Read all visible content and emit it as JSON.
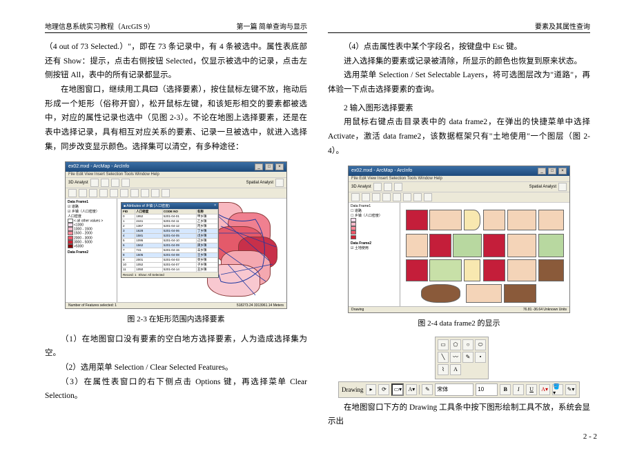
{
  "header": {
    "left": "地理信息系统实习教程（ArcGIS 9）",
    "center": "第一篇 简单查询与显示",
    "right": "要素及其属性查询"
  },
  "left_col": {
    "p1": "（4 out of 73 Selected.）\"，即在 73 条记录中，有 4 条被选中。属性表底部还有 Show：提示，点击右侧按钮 Selected，仅显示被选中的记录，点击左侧按钮 All，表中的所有记录都显示。",
    "p2": "在地图窗口，继续用工具🖾（选择要素），按住鼠标左键不放，拖动后形成一个矩形（俗称开窗），松开鼠标左键，和该矩形相交的要素都被选中，对应的属性记录也选中（见图 2-3）。不论在地图上选择要素，还是在表中选择记录，具有相互对应关系的要素、记录一旦被选中，就进入选择集，同步改变显示颜色。选择集可以清空，有多种途径：",
    "caption": "图 2-3 在矩形范围内选择要素",
    "p3": "（1）在地图窗口没有要素的空白地方选择要素，人为造成选择集为空。",
    "p4": "（2）选用菜单 Selection / Clear Selected Features。",
    "p5": "（3）在属性表窗口的右下侧点击 Options 键，再选择菜单 Clear Selection。"
  },
  "right_col": {
    "p1": "（4）点击属性表中某个字段名，按键盘中 Esc 键。",
    "p2": "进入选择集的要素或记录被清除，所显示的颜色也恢复到原来状态。",
    "p3": "选用菜单 Selection / Set Selectable Layers，将可选图层改为\"道路\"，再体验一下点击选择要素的查询。",
    "section_title": "2 输入图形选择要素",
    "p4": "用鼠标右键点击目录表中的 data frame2，在弹出的快捷菜单中选择 Activate，激活 data frame2，该数据框架只有\"土地使用\"一个图层（图 2-4）。",
    "caption": "图 2-4 data frame2 的显示",
    "p5": "在地图窗口下方的 Drawing 工具条中按下图形绘制工具不放，系统会显示出"
  },
  "arcmap": {
    "title": "ex02.mxd - ArcMap - ArcInfo",
    "menus": "File Edit View Insert Selection Tools Window Help",
    "toolbar_label": "3D Analyst",
    "spatial_label": "Spatial Analyst"
  },
  "fig23": {
    "toc_header": "Data Frame1",
    "layer1": "☑ 道路",
    "layer2": "☑ 乡镇（人口密度）",
    "legend_label": "人口密度",
    "legend_items": [
      "< all other values >",
      "<1000",
      "1000 - 1500",
      "1500 - 2000",
      "2000 - 3000",
      "3000 - 5000",
      ">5000"
    ],
    "toc_item3": "Data Frame2",
    "attr_title": "■ Attributes of 乡镇 (人口密度)",
    "attr_cols": [
      "FID",
      "人口密度",
      "CODE NO",
      "名称"
    ],
    "attr_rows": [
      [
        "0",
        "1952",
        "5201-04-01",
        "甲乡镇"
      ],
      [
        "1",
        "2441",
        "5201-04-11",
        "乙乡镇"
      ],
      [
        "2",
        "1367",
        "5201-04-12",
        "丙乡镇"
      ],
      [
        "3",
        "1628",
        "5201-04-06",
        "丁乡镇"
      ],
      [
        "4",
        "1581",
        "5201-04-05",
        "戊乡镇"
      ],
      [
        "5",
        "1095",
        "5201-04-10",
        "己乡镇"
      ],
      [
        "6",
        "1562",
        "5201-04-09",
        "庚乡镇"
      ],
      [
        "7",
        "741",
        "5201-04-15",
        "辛乡镇"
      ],
      [
        "8",
        "1505",
        "5201-04-08",
        "壬乡镇"
      ],
      [
        "9",
        "2001",
        "5201-04-03",
        "癸乡镇"
      ],
      [
        "10",
        "1052",
        "5201-04-07",
        "子乡镇"
      ],
      [
        "11",
        "1050",
        "5201-04-14",
        "丑乡镇"
      ]
    ],
    "attr_selected_rows": [
      3,
      4,
      6,
      8
    ],
    "attr_record_label": "Record: 1",
    "attr_show": "Show: All Selected",
    "status_left": "Number of Features selected: 1",
    "status_right": "518273.24 3313961.14 Meters"
  },
  "fig24": {
    "toc_item1": "Data Frame1",
    "layer_road": "☐ 道路",
    "layer_town": "☐ 乡镇（人口密度）",
    "toc_item2": "Data Frame2",
    "layer_landuse": "☑ 土地使用",
    "status_left": "Drawing",
    "status_right": "76.81 -36.64 Unknown Units"
  },
  "drawbar": {
    "label": "Drawing",
    "font": "宋体",
    "size": "10",
    "bold": "B",
    "italic": "I",
    "underline": "U"
  },
  "page_number": "2 - 2"
}
